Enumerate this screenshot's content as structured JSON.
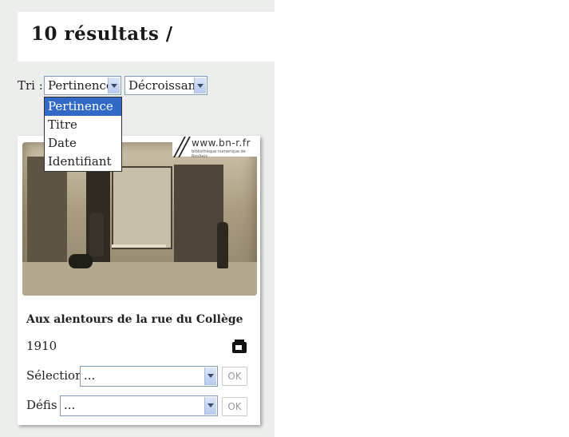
{
  "results": {
    "title": "10 résultats /"
  },
  "sort": {
    "label": "Tri :",
    "field_value": "Pertinence",
    "order_value": "Décroissant",
    "options": [
      "Pertinence",
      "Titre",
      "Date",
      "Identifiant"
    ]
  },
  "card": {
    "watermark": "www.bn-r.fr",
    "watermark_sub": "bibliothèque numérique de Roubaix",
    "title": "Aux alentours de la rue du Collège",
    "date": "1910",
    "media_icon": "image-media-icon",
    "selection_label": "Sélection",
    "selection_value": "...",
    "defis_label": "Défis",
    "defis_value": "...",
    "ok_label": "OK"
  },
  "colors": {
    "panel_bg": "#eceeec",
    "dropdown_selected": "#3169c6",
    "select_border": "#7f9db9"
  }
}
